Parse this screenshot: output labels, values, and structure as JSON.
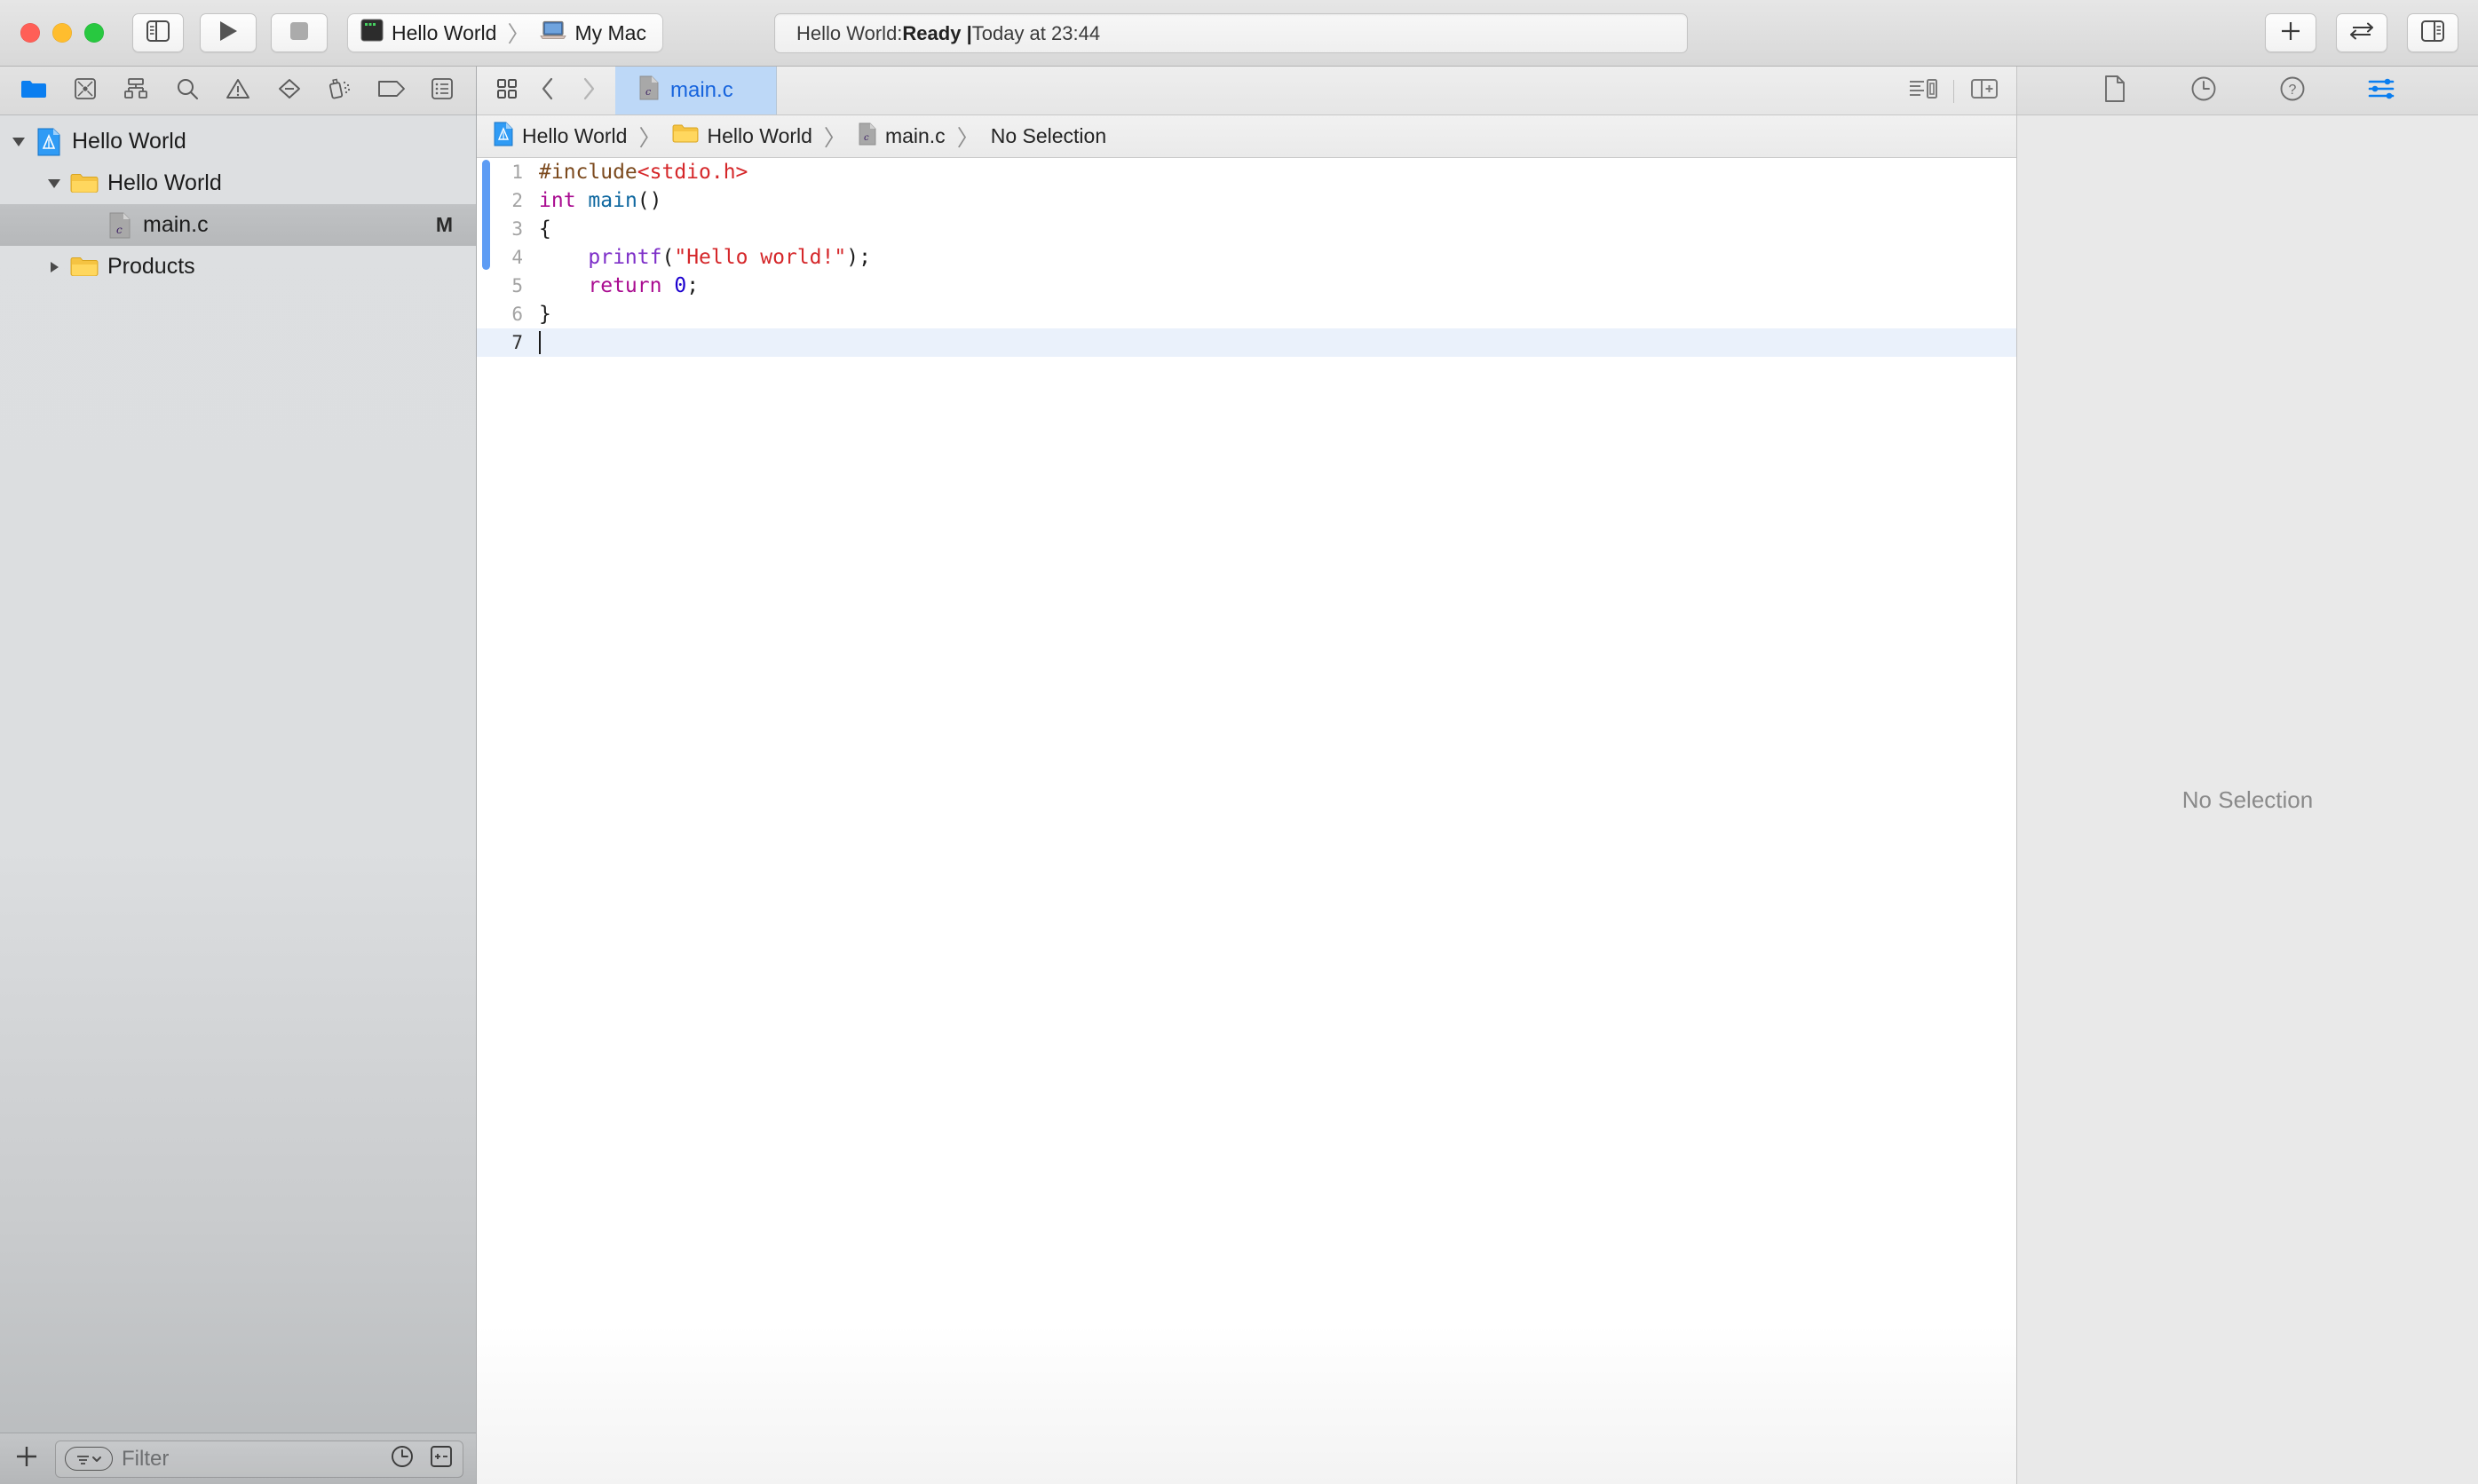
{
  "window": {
    "traffic_lights": [
      "close",
      "minimize",
      "zoom"
    ],
    "colors": {
      "red": "#ff5f57",
      "yellow": "#ffbd2e",
      "green": "#28c840",
      "accent": "#1764dd",
      "modified_bar": "#5d9cf4"
    }
  },
  "toolbar": {
    "navigator_toggle_label": "Toggle Navigator",
    "run_label": "Run",
    "stop_label": "Stop",
    "scheme": {
      "project": "Hello World",
      "separator": "〉",
      "destination": "My Mac"
    },
    "status": {
      "prefix": "Hello World: ",
      "state": "Ready | ",
      "detail": "Today at 23:44"
    },
    "right_buttons": [
      {
        "name": "add-button",
        "label": "+"
      },
      {
        "name": "swap-editors-button",
        "label": "⇄"
      },
      {
        "name": "inspector-toggle-button",
        "label": "Toggle Inspector"
      }
    ]
  },
  "navigator": {
    "tabs": [
      {
        "name": "project-navigator",
        "label": "Project",
        "selected": true
      },
      {
        "name": "source-control-navigator",
        "label": "Source Control",
        "selected": false
      },
      {
        "name": "symbol-navigator",
        "label": "Symbol",
        "selected": false
      },
      {
        "name": "find-navigator",
        "label": "Find",
        "selected": false
      },
      {
        "name": "issue-navigator",
        "label": "Issue",
        "selected": false
      },
      {
        "name": "test-navigator",
        "label": "Test",
        "selected": false
      },
      {
        "name": "debug-navigator",
        "label": "Debug",
        "selected": false
      },
      {
        "name": "breakpoint-navigator",
        "label": "Breakpoint",
        "selected": false
      },
      {
        "name": "report-navigator",
        "label": "Report",
        "selected": false
      }
    ],
    "tree": [
      {
        "label": "Hello World",
        "icon": "xcode-project-icon",
        "depth": 0,
        "expanded": true,
        "selected": false,
        "badge": ""
      },
      {
        "label": "Hello World",
        "icon": "folder-icon",
        "depth": 1,
        "expanded": true,
        "selected": false,
        "badge": ""
      },
      {
        "label": "main.c",
        "icon": "c-file-icon",
        "depth": 2,
        "expanded": null,
        "selected": true,
        "badge": "M"
      },
      {
        "label": "Products",
        "icon": "folder-icon",
        "depth": 1,
        "expanded": false,
        "selected": false,
        "badge": ""
      }
    ],
    "footer": {
      "add_label": "+",
      "filter_placeholder": "Filter",
      "recent_label": "Recent Files",
      "source_control_label": "Show Source Control Changes"
    }
  },
  "editor": {
    "tab_tools": {
      "grid_label": "Show Related Items",
      "back_label": "Back",
      "forward_label": "Forward"
    },
    "open_tabs": [
      {
        "label": "main.c",
        "icon": "c-file-icon",
        "selected": true
      }
    ],
    "right_tools": [
      {
        "name": "minimap-toggle-button",
        "label": "Hide Minimap"
      },
      {
        "name": "add-editor-button",
        "label": "Add Editor"
      }
    ],
    "breadcrumb": [
      {
        "label": "Hello World",
        "icon": "xcode-project-icon"
      },
      {
        "label": "Hello World",
        "icon": "folder-icon"
      },
      {
        "label": "main.c",
        "icon": "c-file-icon"
      },
      {
        "label": "No Selection",
        "icon": ""
      }
    ],
    "breadcrumb_separator": "〉",
    "code": {
      "language": "c",
      "current_line": 7,
      "modified_lines": [
        1,
        2,
        3,
        4
      ],
      "lines": [
        {
          "n": "1",
          "tokens": [
            {
              "t": "#include",
              "c": "s-pre"
            },
            {
              "t": "<stdio.h>",
              "c": "s-str"
            }
          ]
        },
        {
          "n": "2",
          "tokens": [
            {
              "t": "int",
              "c": "s-kw"
            },
            {
              "t": " ",
              "c": "s-plain"
            },
            {
              "t": "main",
              "c": "s-fn"
            },
            {
              "t": "()",
              "c": "s-plain"
            }
          ]
        },
        {
          "n": "3",
          "tokens": [
            {
              "t": "{",
              "c": "s-plain"
            }
          ]
        },
        {
          "n": "4",
          "tokens": [
            {
              "t": "    ",
              "c": "s-plain"
            },
            {
              "t": "printf",
              "c": "s-call"
            },
            {
              "t": "(",
              "c": "s-plain"
            },
            {
              "t": "\"Hello world!\"",
              "c": "s-str"
            },
            {
              "t": ");",
              "c": "s-plain"
            }
          ]
        },
        {
          "n": "5",
          "tokens": [
            {
              "t": "    ",
              "c": "s-plain"
            },
            {
              "t": "return",
              "c": "s-kw"
            },
            {
              "t": " ",
              "c": "s-plain"
            },
            {
              "t": "0",
              "c": "s-num"
            },
            {
              "t": ";",
              "c": "s-plain"
            }
          ]
        },
        {
          "n": "6",
          "tokens": [
            {
              "t": "}",
              "c": "s-plain"
            }
          ]
        },
        {
          "n": "7",
          "tokens": []
        }
      ]
    }
  },
  "inspector": {
    "tabs": [
      {
        "name": "file-inspector-tab",
        "label": "File Inspector",
        "selected": false
      },
      {
        "name": "history-inspector-tab",
        "label": "History Inspector",
        "selected": false
      },
      {
        "name": "help-inspector-tab",
        "label": "Quick Help",
        "selected": false
      },
      {
        "name": "attributes-inspector-tab",
        "label": "Attributes",
        "selected": true
      }
    ],
    "empty_message": "No Selection"
  }
}
